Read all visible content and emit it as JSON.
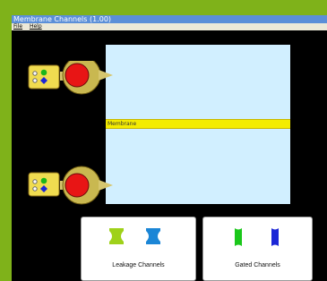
{
  "window": {
    "title": "Membrane Channels (1.00)"
  },
  "menu": {
    "file": "File",
    "help": "Help"
  },
  "membrane": {
    "label": "Membrane"
  },
  "panels": {
    "leakage": "Leakage Channels",
    "gated": "Gated Channels"
  },
  "colors": {
    "background": "#7fb21a",
    "chamber": "#d1efff",
    "membrane": "#f4ec00",
    "leak_green": "#9fd11a",
    "leak_blue": "#1b86d6",
    "gated_green": "#1ac71a",
    "gated_blue": "#1b26d6"
  }
}
